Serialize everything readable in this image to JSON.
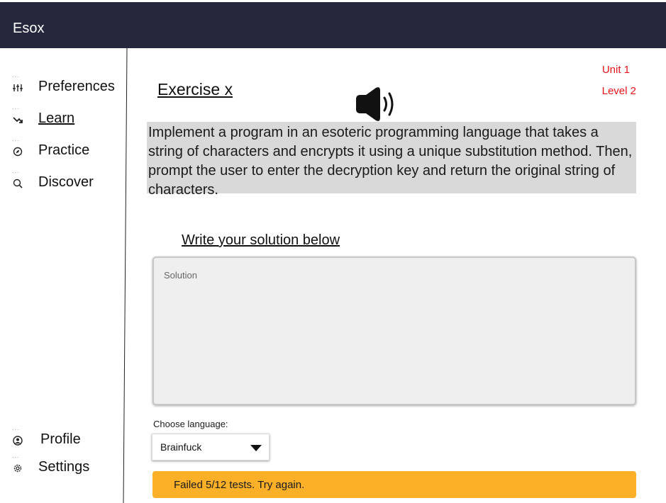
{
  "app": {
    "title": "Esox"
  },
  "sidebar": {
    "items": [
      {
        "label": "Preferences",
        "icon": "sliders-icon"
      },
      {
        "label": "Learn",
        "icon": "trend-arrow-icon"
      },
      {
        "label": "Practice",
        "icon": "compass-icon"
      },
      {
        "label": "Discover",
        "icon": "search-icon"
      }
    ],
    "bottom_items": [
      {
        "label": "Profile",
        "icon": "user-circle-icon"
      },
      {
        "label": "Settings",
        "icon": "gear-icon"
      }
    ],
    "dots": "..."
  },
  "exercise": {
    "title": "Exercise x",
    "unit": "Unit 1",
    "level": "Level 2",
    "prompt": "Implement a program in an esoteric programming language that takes a string of characters and encrypts it using a unique substitution method. Then, prompt the user to enter the decryption key and return the original string of characters."
  },
  "solution": {
    "heading": "Write your solution below",
    "placeholder": "Solution",
    "value": ""
  },
  "language": {
    "label": "Choose language:",
    "selected": "Brainfuck"
  },
  "status": {
    "message": "Failed 5/12 tests. Try again.",
    "color": "#fbb028"
  },
  "colors": {
    "topbar": "#25273c",
    "accent_red": "#e8141b",
    "prompt_bg": "#d9d9d9"
  }
}
